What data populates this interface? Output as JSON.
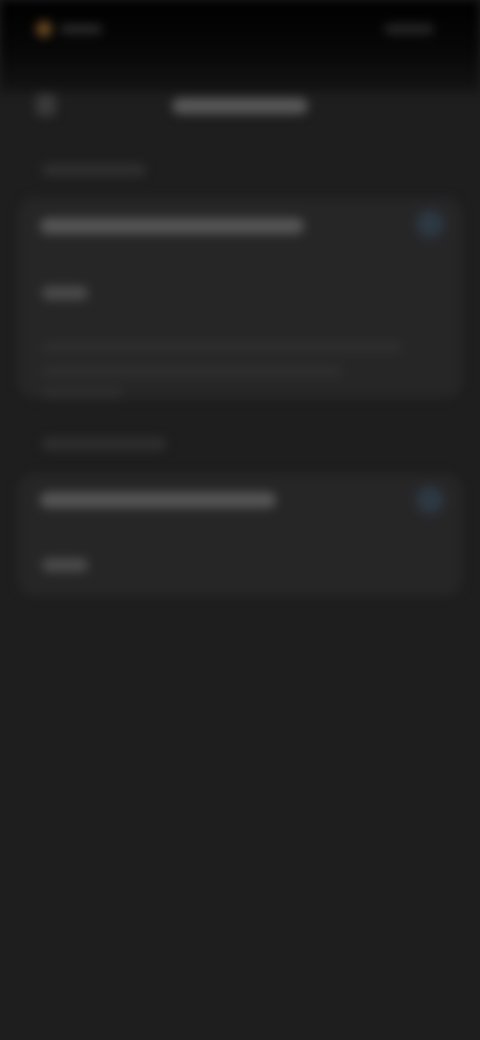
{
  "status_bar": {
    "left_text": "",
    "right_text": ""
  },
  "header": {
    "title": ""
  },
  "sections": [
    {
      "label": "",
      "row_title": "",
      "small_label": "",
      "description": ""
    },
    {
      "label": "",
      "row_title": "",
      "small_label": ""
    }
  ],
  "icons": {
    "back": "chevron-left-icon",
    "row_1": "info-icon",
    "row_2": "info-icon"
  },
  "colors": {
    "background": "#1e1e1f",
    "card": "#262627",
    "accent": "#6b4a22"
  }
}
